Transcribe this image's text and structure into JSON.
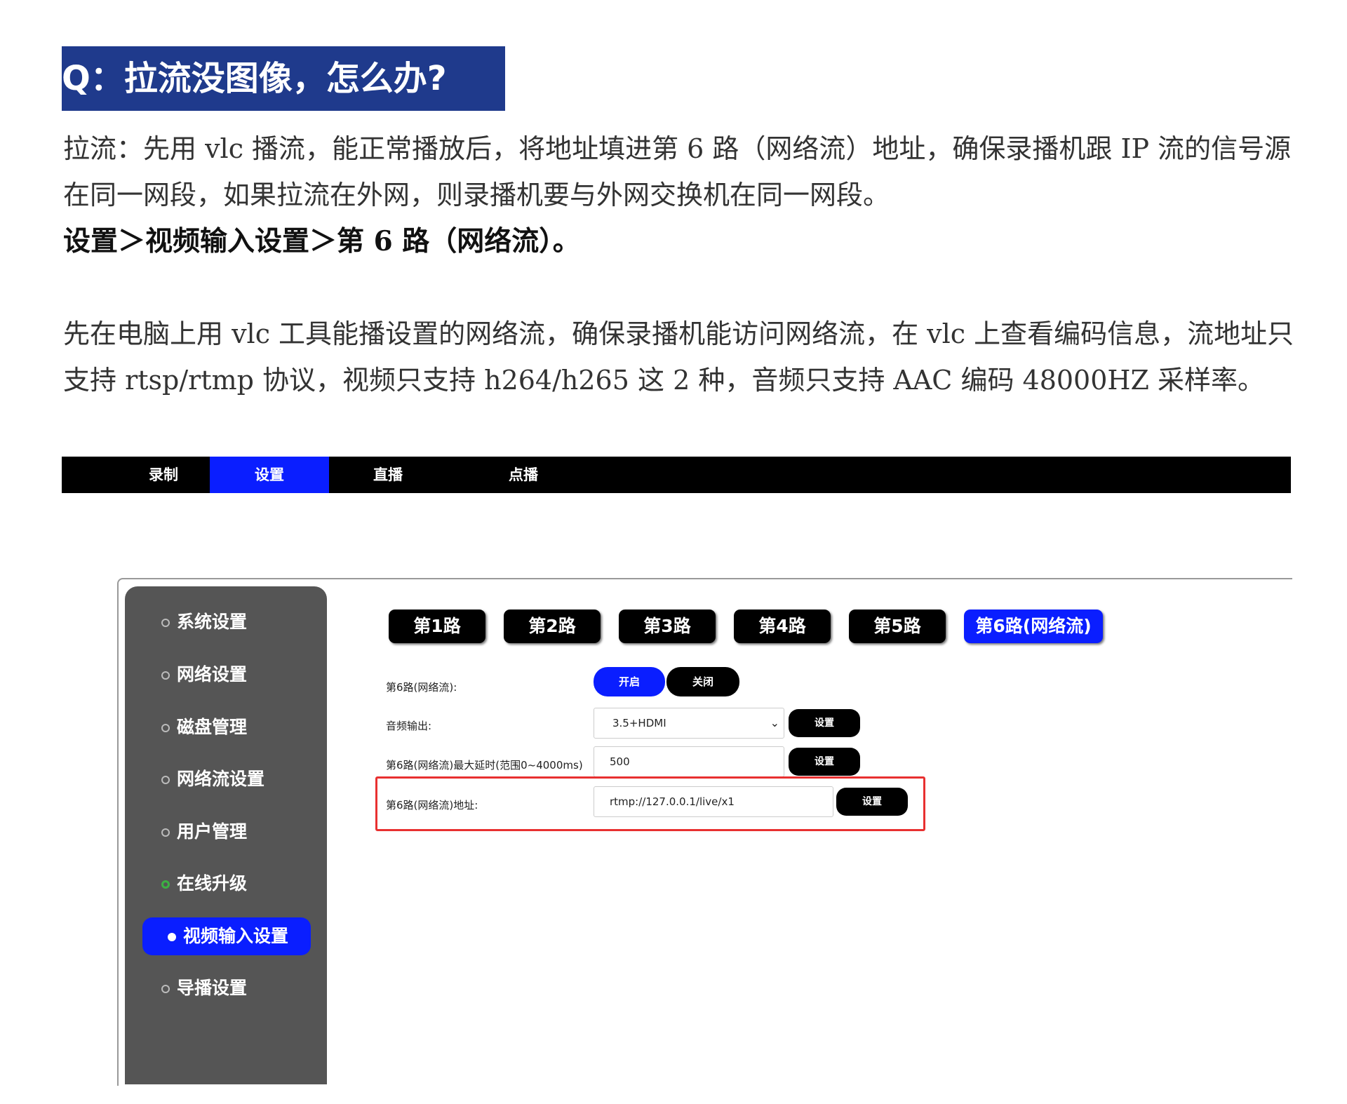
{
  "heading": "Q：拉流没图像，怎么办?",
  "paragraph1": "拉流：先用 vlc 播流，能正常播放后，将地址填进第 6 路（网络流）地址，确保录播机跟 IP 流的信号源在同一网段，如果拉流在外网，则录播机要与外网交换机在同一网段。",
  "path_line": "设置＞视频输入设置＞第 6 路（网络流）。",
  "paragraph2": "先在电脑上用 vlc 工具能播设置的网络流，确保录播机能访问网络流，在 vlc 上查看编码信息，流地址只支持 rtsp/rtmp 协议，视频只支持 h264/h265 这 2 种，音频只支持 AAC 编码 48000HZ 采样率。",
  "topnav": {
    "tabs": [
      "录制",
      "设置",
      "直播",
      "点播"
    ],
    "active": "设置"
  },
  "sidebar": {
    "items": [
      "系统设置",
      "网络设置",
      "磁盘管理",
      "网络流设置",
      "用户管理",
      "在线升级",
      "视频输入设置",
      "导播设置"
    ],
    "active": "视频输入设置"
  },
  "channels": {
    "tabs": [
      "第1路",
      "第2路",
      "第3路",
      "第4路",
      "第5路",
      "第6路(网络流)"
    ],
    "active": "第6路(网络流)"
  },
  "form": {
    "enable_label": "第6路(网络流):",
    "enable_on": "开启",
    "enable_off": "关闭",
    "audio_label": "音频输出:",
    "audio_value": "3.5+HDMI",
    "delay_label": "第6路(网络流)最大延时(范围0~4000ms)",
    "delay_value": "500",
    "address_label": "第6路(网络流)地址:",
    "address_value": "rtmp://127.0.0.1/live/x1",
    "set_label": "设置"
  },
  "colors": {
    "accent_blue": "#0a1eff",
    "heading_bg": "#1f3a8c",
    "highlight": "#e83030"
  }
}
